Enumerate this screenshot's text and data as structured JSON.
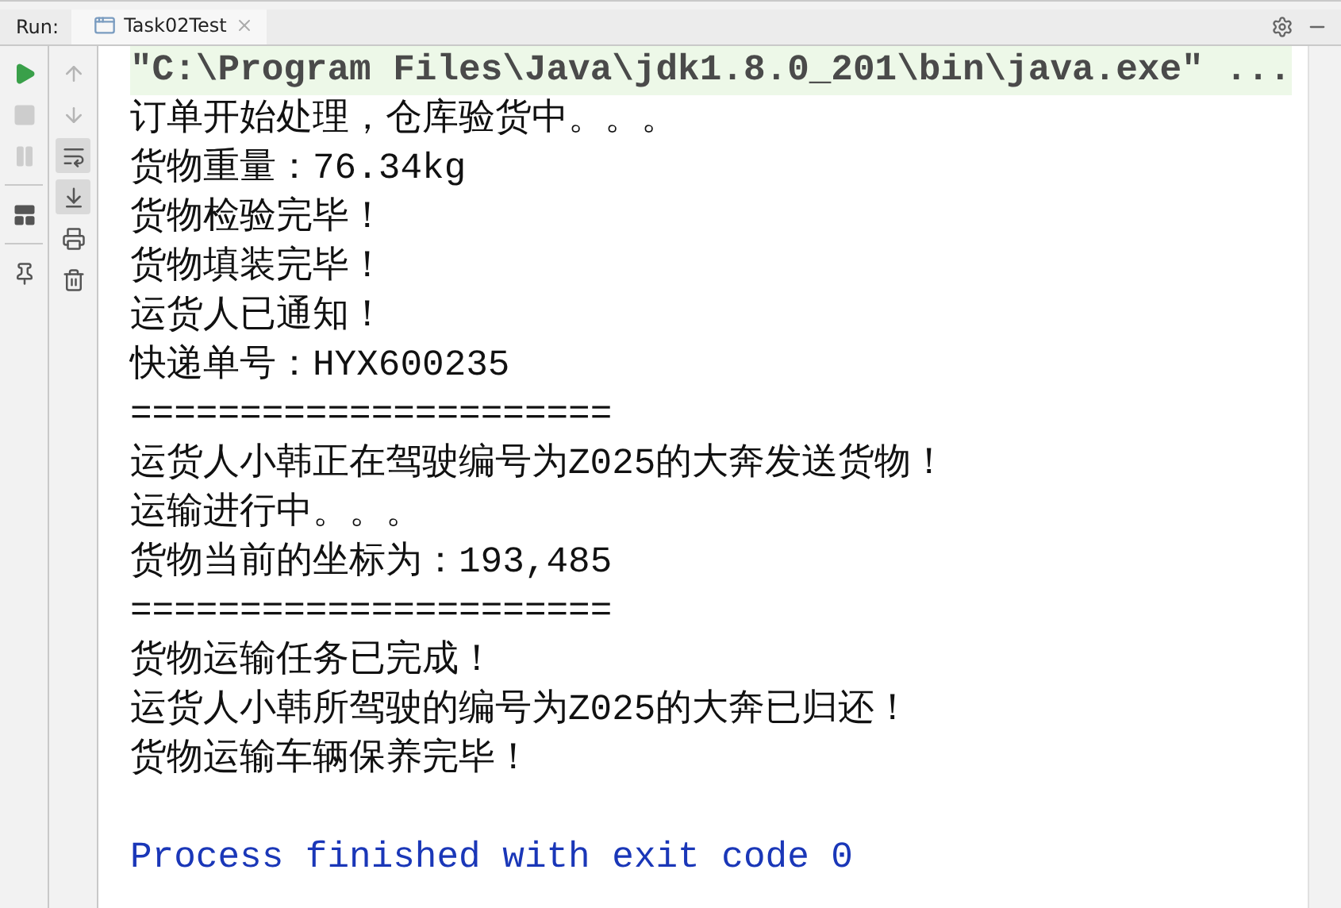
{
  "run_panel": {
    "label": "Run:",
    "tabs": [
      {
        "label": "Task02Test",
        "selected": true
      }
    ]
  },
  "left_toolbar": [
    {
      "kind": "run",
      "disabled": false
    },
    {
      "kind": "stop",
      "disabled": true
    },
    {
      "kind": "pause",
      "disabled": true
    },
    {
      "kind": "divider"
    },
    {
      "kind": "layout",
      "disabled": false
    },
    {
      "kind": "divider"
    },
    {
      "kind": "pin",
      "disabled": false
    }
  ],
  "right_toolbar": [
    {
      "kind": "up",
      "on": false,
      "disabled": true
    },
    {
      "kind": "down",
      "on": false,
      "disabled": true
    },
    {
      "kind": "wrap",
      "on": true,
      "disabled": false
    },
    {
      "kind": "scroll-end",
      "on": true,
      "disabled": false
    },
    {
      "kind": "print",
      "on": false,
      "disabled": false
    },
    {
      "kind": "trash",
      "on": false,
      "disabled": false
    }
  ],
  "console": [
    {
      "kind": "command",
      "text": "\"C:\\Program Files\\Java\\jdk1.8.0_201\\bin\\java.exe\" ..."
    },
    {
      "kind": "output",
      "text": "订单开始处理，仓库验货中。。。"
    },
    {
      "kind": "output",
      "text": "货物重量：76.34kg"
    },
    {
      "kind": "output",
      "text": "货物检验完毕！"
    },
    {
      "kind": "output",
      "text": "货物填装完毕！"
    },
    {
      "kind": "output",
      "text": "运货人已通知！"
    },
    {
      "kind": "output",
      "text": "快递单号：HYX600235"
    },
    {
      "kind": "output",
      "text": "======================"
    },
    {
      "kind": "output",
      "text": "运货人小韩正在驾驶编号为Z025的大奔发送货物！"
    },
    {
      "kind": "output",
      "text": "运输进行中。。。"
    },
    {
      "kind": "output",
      "text": "货物当前的坐标为：193,485"
    },
    {
      "kind": "output",
      "text": "======================"
    },
    {
      "kind": "output",
      "text": "货物运输任务已完成！"
    },
    {
      "kind": "output",
      "text": "运货人小韩所驾驶的编号为Z025的大奔已归还！"
    },
    {
      "kind": "output",
      "text": "货物运输车辆保养完毕！"
    },
    {
      "kind": "exit",
      "text": "Process finished with exit code 0"
    }
  ]
}
